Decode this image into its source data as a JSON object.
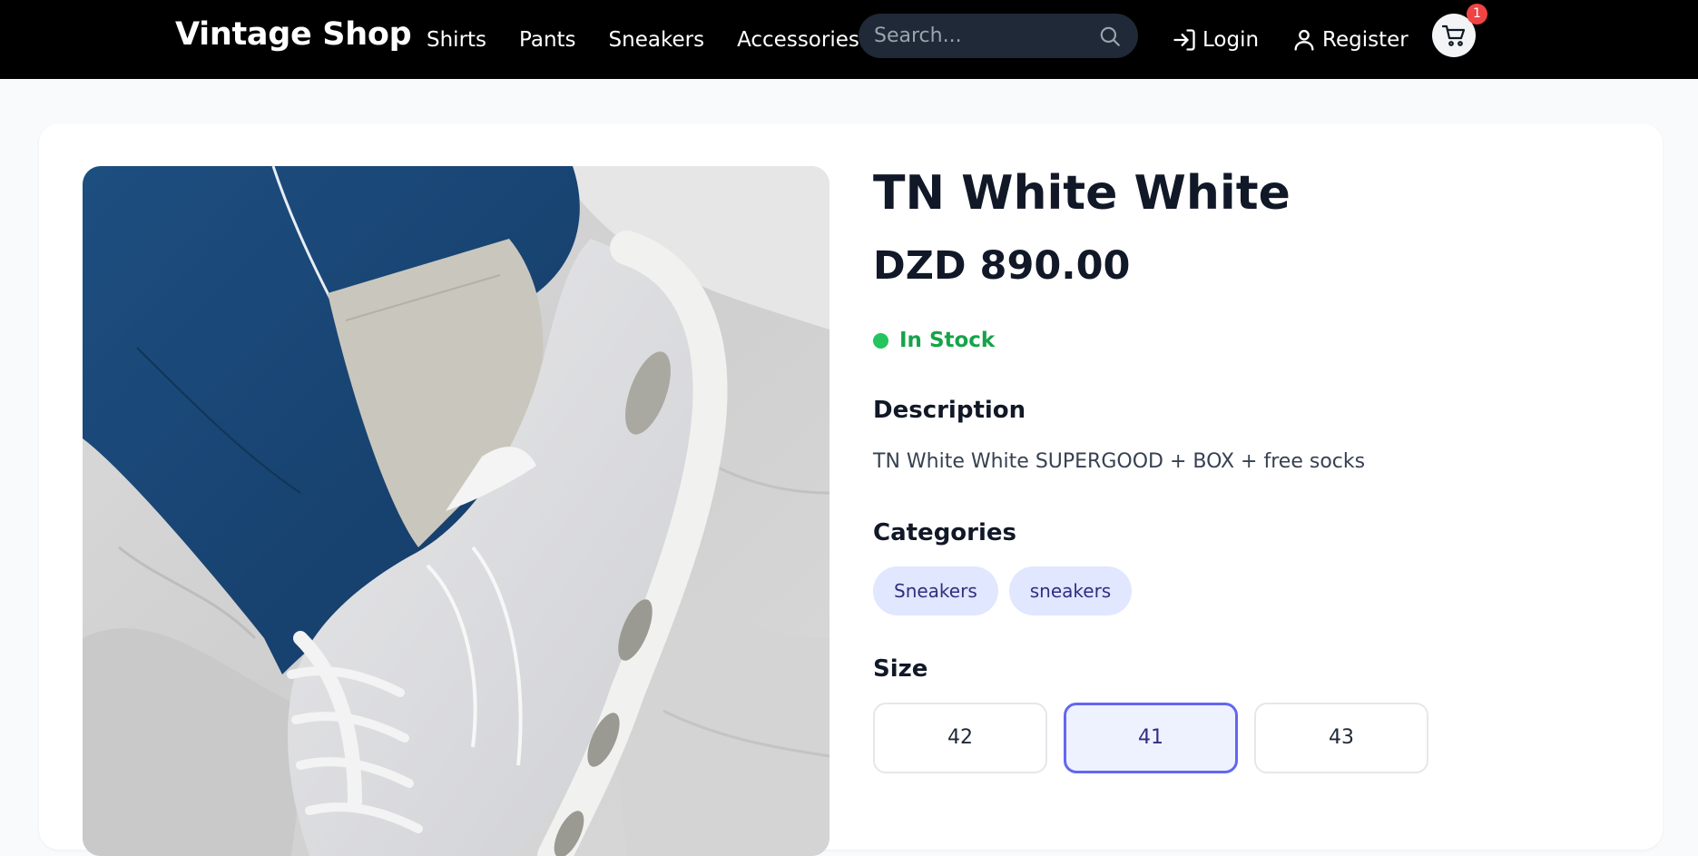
{
  "nav": {
    "brand": "Vintage Shop",
    "links": [
      "Shirts",
      "Pants",
      "Sneakers",
      "Accessories"
    ],
    "search_placeholder": "Search...",
    "login_label": "Login",
    "register_label": "Register",
    "cart_count": "1"
  },
  "product": {
    "title": "TN White White",
    "price": "DZD 890.00",
    "stock_status": "In Stock",
    "description_heading": "Description",
    "description": "TN White White SUPERGOOD + BOX + free socks",
    "categories_heading": "Categories",
    "categories": [
      "Sneakers",
      "sneakers"
    ],
    "size_heading": "Size",
    "sizes": [
      "42",
      "41",
      "43"
    ],
    "selected_size": "41"
  },
  "colors": {
    "navbar_bg": "#000000",
    "accent": "#6366f1",
    "stock_green": "#16a34a",
    "badge_red": "#ef4444",
    "chip_bg": "#e0e7ff"
  },
  "icons": {
    "search": "search-icon",
    "login": "login-icon",
    "register": "user-icon",
    "cart": "cart-icon"
  }
}
